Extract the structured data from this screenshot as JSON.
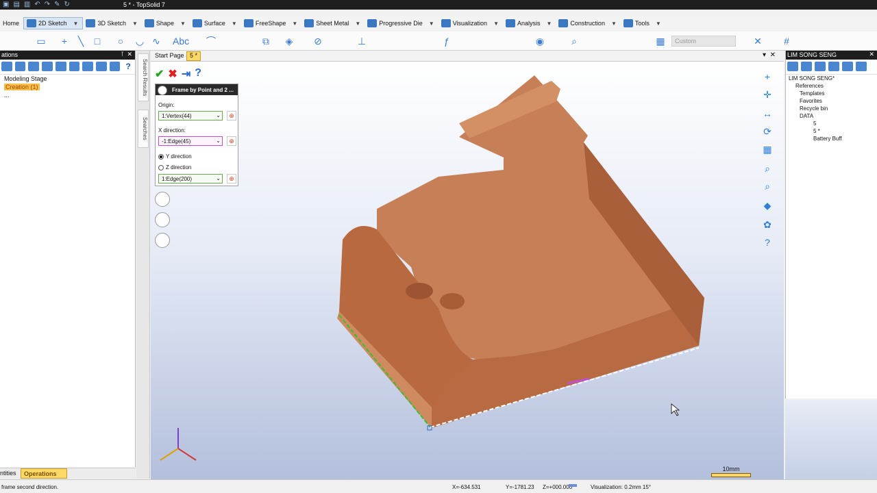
{
  "window": {
    "title": "5 * - TopSolid 7"
  },
  "menus": [
    {
      "label": "Home"
    },
    {
      "label": "2D Sketch"
    },
    {
      "label": "3D Sketch"
    },
    {
      "label": "Shape"
    },
    {
      "label": "Surface"
    },
    {
      "label": "FreeShape"
    },
    {
      "label": "Sheet Metal"
    },
    {
      "label": "Progressive Die"
    },
    {
      "label": "Visualization"
    },
    {
      "label": "Analysis"
    },
    {
      "label": "Construction"
    },
    {
      "label": "Tools"
    }
  ],
  "toolbar": {
    "custom_placeholder": "Custom"
  },
  "left_panel": {
    "header": "ations",
    "tree": [
      "Modeling Stage",
      "Creation (1)",
      "..."
    ],
    "bottom_tabs": [
      "ntities",
      "Operations"
    ]
  },
  "side_tabs": [
    "Search Results",
    "Searches"
  ],
  "doc_tabs": [
    "Start Page",
    "5 *"
  ],
  "dialog": {
    "title": "Frame by Point and 2 ...",
    "origin_label": "Origin:",
    "origin_value": "1:Vertex(44)",
    "x_dir_label": "X direction:",
    "x_dir_value": "-1:Edge(45)",
    "y_radio": "Y direction",
    "z_radio": "Z direction",
    "third_value": "1:Edge(200)",
    "y_selected": true
  },
  "scale_label": "10mm",
  "right_panel": {
    "header": "LIM SONG SENG",
    "tree": [
      "LIM SONG SENG*",
      "References",
      "Templates",
      "Favorites",
      "Recycle bin",
      "DATA",
      "5",
      "5 *",
      "Battery Buff"
    ]
  },
  "status": {
    "message": "frame second direction.",
    "x": "X=-634.531",
    "y": "Y=-1781.23",
    "z": "Z=+000.000",
    "visualization": "Visualization: 0.2mm 15°"
  },
  "colors": {
    "part": "#c97a4e",
    "accent": "#ffd966",
    "title_bg": "#1e1e1e"
  }
}
